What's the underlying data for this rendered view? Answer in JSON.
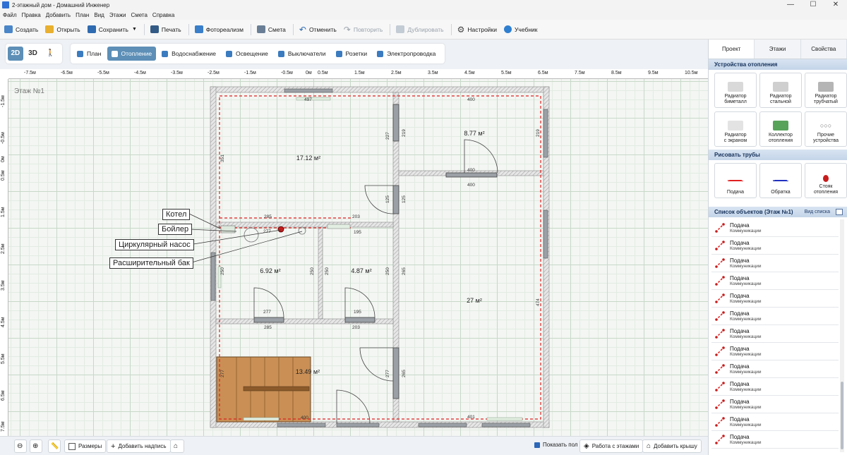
{
  "window": {
    "title": "2-этажный дом - Домашний Инженер",
    "min": "—",
    "max": "☐",
    "close": "✕"
  },
  "menu": [
    "Файл",
    "Правка",
    "Добавить",
    "План",
    "Вид",
    "Этажи",
    "Смета",
    "Справка"
  ],
  "toolbar": {
    "create": "Создать",
    "open": "Открыть",
    "save": "Сохранить",
    "print": "Печать",
    "photo": "Фотореализм",
    "estimate": "Смета",
    "undo": "Отменить",
    "redo": "Повторить",
    "duplicate": "Дублировать",
    "settings": "Настройки",
    "tutorial": "Учебник"
  },
  "view_switch": {
    "v2d": "2D",
    "v3d": "3D",
    "walk": "🚶"
  },
  "mode_tabs": [
    {
      "label": "План",
      "active": false
    },
    {
      "label": "Отопление",
      "active": true
    },
    {
      "label": "Водоснабжение",
      "active": false
    },
    {
      "label": "Освещение",
      "active": false
    },
    {
      "label": "Выключатели",
      "active": false
    },
    {
      "label": "Розетки",
      "active": false
    },
    {
      "label": "Электропроводка",
      "active": false
    }
  ],
  "canvas": {
    "floor": "Этаж №1",
    "h_ticks": [
      "-7.5м",
      "-6.5м",
      "-5.5м",
      "-4.5м",
      "-3.5м",
      "-2.5м",
      "-1.5м",
      "-0.5м",
      "0м",
      "0.5м",
      "1.5м",
      "2.5м",
      "3.5м",
      "4.5м",
      "5.5м",
      "6.5м",
      "7.5м",
      "8.5м",
      "9.5м",
      "10.5м"
    ],
    "v_ticks": [
      "-1.5м",
      "-0.5м",
      "0м",
      "0.5м",
      "1.5м",
      "2.5м",
      "3.5м",
      "4.5м",
      "5.5м",
      "6.5м",
      "7.5м"
    ],
    "rooms": [
      "17.12 м²",
      "8.77 м²",
      "6.92 м²",
      "4.87 м²",
      "27 м²",
      "13.49 м²"
    ],
    "dims": [
      "497",
      "400",
      "227",
      "219",
      "351",
      "400",
      "400",
      "125",
      "125",
      "285",
      "203",
      "277",
      "195",
      "250",
      "250",
      "250",
      "250",
      "265",
      "277",
      "285",
      "195",
      "203",
      "474",
      "277",
      "265",
      "277",
      "401",
      "400",
      "219"
    ],
    "callouts": [
      "Котел",
      "Бойлер",
      "Циркулярный насос",
      "Расширительный бак"
    ]
  },
  "bottom": {
    "dims": "Размеры",
    "add_label": "Добавить надпись",
    "show_floor": "Показать пол",
    "floors": "Работа с этажами",
    "roof": "Добавить крышу"
  },
  "panel": {
    "tabs": [
      "Проект",
      "Этажи",
      "Свойства"
    ],
    "heating_header": "Устройства отопления",
    "devices": [
      {
        "label": "Радиатор\nбиметалл"
      },
      {
        "label": "Радиатор\nстальной"
      },
      {
        "label": "Радиатор\nтрубчатый"
      },
      {
        "label": "Радиатор\nс экраном"
      },
      {
        "label": "Коллектор\nотопления"
      },
      {
        "label": "Прочие\nустройства"
      }
    ],
    "pipes_header": "Рисовать трубы",
    "pipes": [
      {
        "label": "Подача"
      },
      {
        "label": "Обратка"
      },
      {
        "label": "Стояк\nотопления"
      }
    ],
    "objects_header": "Список объектов (Этаж №1)",
    "view_list": "Вид списка",
    "objects": [
      {
        "name": "Подача",
        "type": "Коммуникации"
      },
      {
        "name": "Подача",
        "type": "Коммуникации"
      },
      {
        "name": "Подача",
        "type": "Коммуникации"
      },
      {
        "name": "Подача",
        "type": "Коммуникации"
      },
      {
        "name": "Подача",
        "type": "Коммуникации"
      },
      {
        "name": "Подача",
        "type": "Коммуникации"
      },
      {
        "name": "Подача",
        "type": "Коммуникации"
      },
      {
        "name": "Подача",
        "type": "Коммуникации"
      },
      {
        "name": "Подача",
        "type": "Коммуникации"
      },
      {
        "name": "Подача",
        "type": "Коммуникации"
      },
      {
        "name": "Подача",
        "type": "Коммуникации"
      },
      {
        "name": "Подача",
        "type": "Коммуникации"
      },
      {
        "name": "Подача",
        "type": "Коммуникации"
      }
    ]
  },
  "colors": {
    "accent": "#5d8fb7",
    "pipe_supply": "#e02020",
    "wall": "#b9b9b9",
    "stairs": "#c98f55"
  }
}
